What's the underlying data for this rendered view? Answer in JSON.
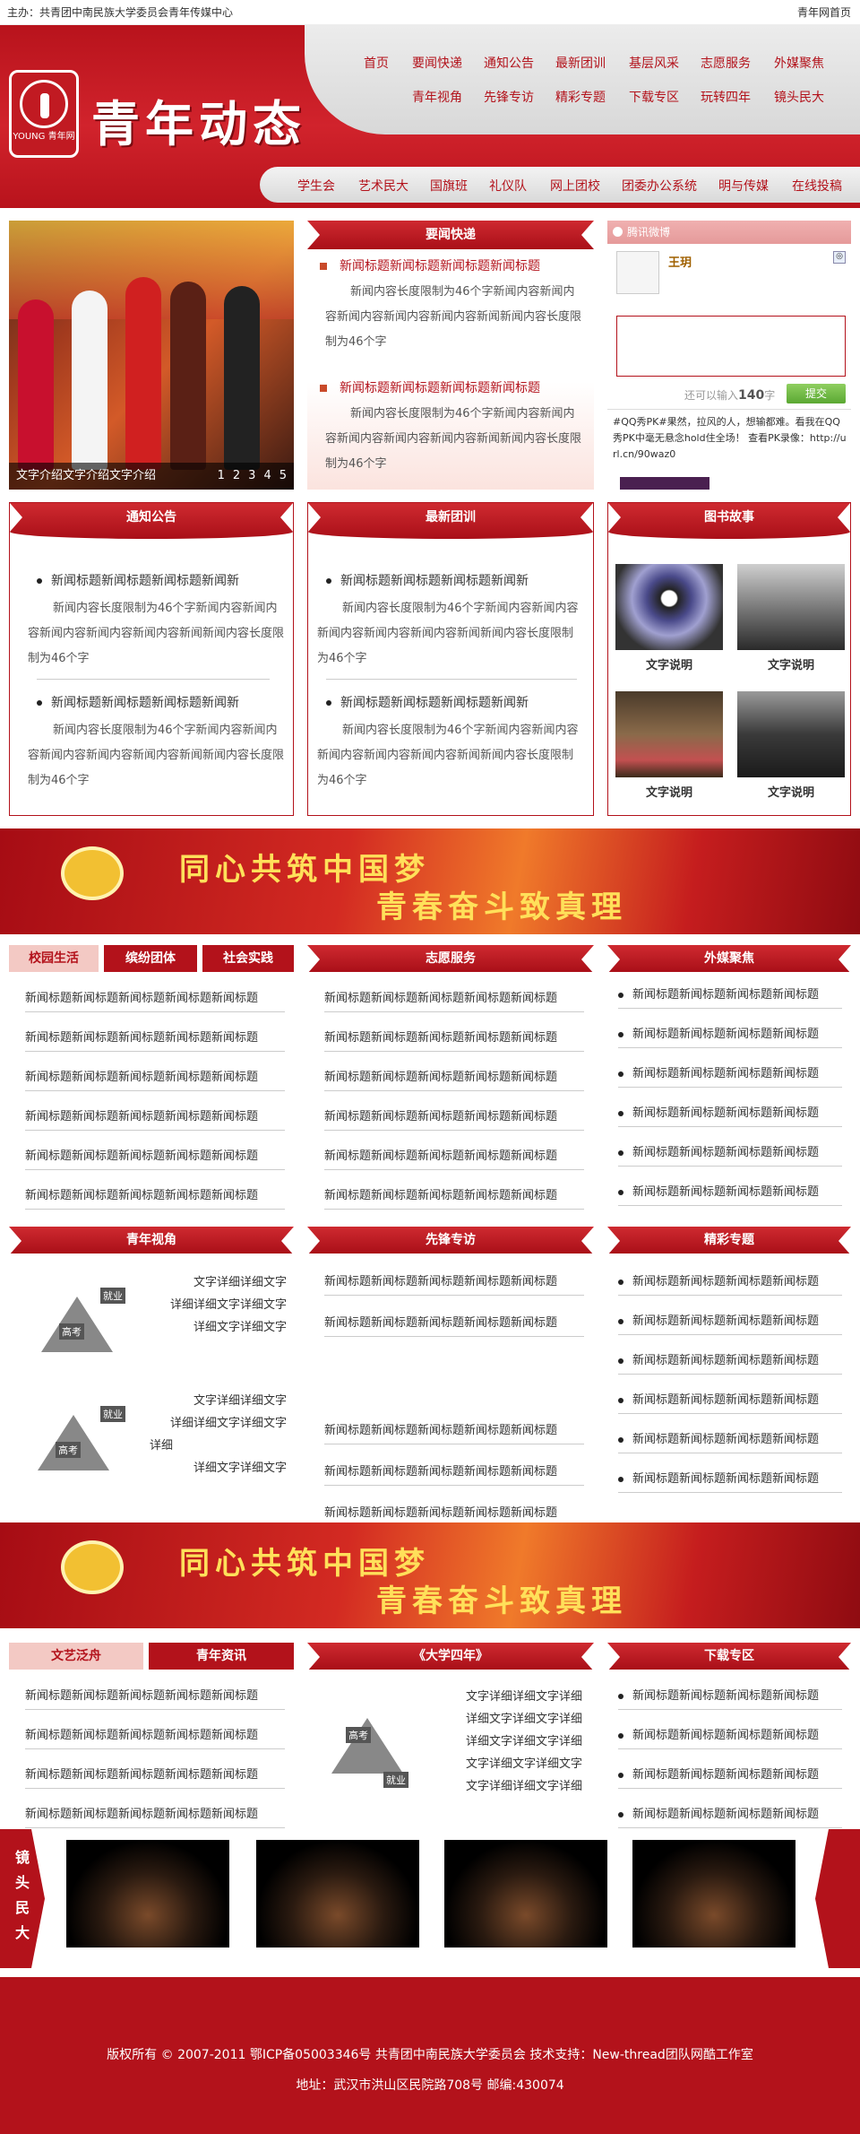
{
  "topbar": {
    "left": "主办：共青团中南民族大学委员会青年传媒中心",
    "right": "青年网首页"
  },
  "header": {
    "logo_text": "YOUNG 青年网",
    "title": "青年动态",
    "nav_row1": [
      "首页",
      "要闻快递",
      "通知公告",
      "最新团训",
      "基层风采",
      "志愿服务",
      "外媒聚焦"
    ],
    "nav_row2": [
      "青年视角",
      "先锋专访",
      "精彩专题",
      "下载专区",
      "玩转四年",
      "镜头民大"
    ],
    "subnav": [
      "学生会",
      "艺术民大",
      "国旗班",
      "礼仪队",
      "网上团校",
      "团委办公系统",
      "明与传媒",
      "在线投稿"
    ]
  },
  "slideshow": {
    "caption": "文字介绍文字介绍文字介绍",
    "pages": [
      "1",
      "2",
      "3",
      "4",
      "5"
    ]
  },
  "yaowen": {
    "title": "要闻快递",
    "items": [
      {
        "title": "新闻标题新闻标题新闻标题新闻标题",
        "desc": "新闻内容长度限制为46个字新闻内容新闻内容新闻内容新闻内容新闻内容新闻新闻内容长度限制为46个字"
      },
      {
        "title": "新闻标题新闻标题新闻标题新闻标题",
        "desc": "新闻内容长度限制为46个字新闻内容新闻内容新闻内容新闻内容新闻内容新闻新闻内容长度限制为46个字"
      }
    ]
  },
  "weibo": {
    "bar": "腾讯微博",
    "user": "王玥",
    "counter_prefix": "还可以输入",
    "counter_num": "140",
    "counter_suffix": "字",
    "submit": "提交",
    "feed": "#QQ秀PK#果然，拉风的人，想输都难。看我在QQ秀PK中毫无悬念hold住全场！ 查看PK录像：http://url.cn/90waz0"
  },
  "notice": {
    "title": "通知公告",
    "items": [
      {
        "title": "新闻标题新闻标题新闻标题新闻新",
        "desc": "新闻内容长度限制为46个字新闻内容新闻内容新闻内容新闻内容新闻内容新闻新闻内容长度限制为46个字"
      },
      {
        "title": "新闻标题新闻标题新闻标题新闻新",
        "desc": "新闻内容长度限制为46个字新闻内容新闻内容新闻内容新闻内容新闻内容新闻新闻内容长度限制为46个字"
      }
    ]
  },
  "tuanxun": {
    "title": "最新团训",
    "items": [
      {
        "title": "新闻标题新闻标题新闻标题新闻新",
        "desc": "新闻内容长度限制为46个字新闻内容新闻内容新闻内容新闻内容新闻内容新闻新闻内容长度限制为46个字"
      },
      {
        "title": "新闻标题新闻标题新闻标题新闻新",
        "desc": "新闻内容长度限制为46个字新闻内容新闻内容新闻内容新闻内容新闻内容新闻新闻内容长度限制为46个字"
      }
    ]
  },
  "books": {
    "title": "图书故事",
    "captions": [
      "文字说明",
      "文字说明",
      "文字说明",
      "文字说明"
    ]
  },
  "banner": {
    "line1": "同心共筑中国梦",
    "line2": "青春奋斗致真理"
  },
  "campus": {
    "tabs": [
      "校园生活",
      "缤纷团体",
      "社会实践"
    ],
    "items": [
      "新闻标题新闻标题新闻标题新闻标题新闻标题",
      "新闻标题新闻标题新闻标题新闻标题新闻标题",
      "新闻标题新闻标题新闻标题新闻标题新闻标题",
      "新闻标题新闻标题新闻标题新闻标题新闻标题",
      "新闻标题新闻标题新闻标题新闻标题新闻标题",
      "新闻标题新闻标题新闻标题新闻标题新闻标题"
    ]
  },
  "volunteer": {
    "title": "志愿服务",
    "items": [
      "新闻标题新闻标题新闻标题新闻标题新闻标题",
      "新闻标题新闻标题新闻标题新闻标题新闻标题",
      "新闻标题新闻标题新闻标题新闻标题新闻标题",
      "新闻标题新闻标题新闻标题新闻标题新闻标题",
      "新闻标题新闻标题新闻标题新闻标题新闻标题",
      "新闻标题新闻标题新闻标题新闻标题新闻标题"
    ]
  },
  "foreign": {
    "title": "外媒聚焦",
    "items": [
      "新闻标题新闻标题新闻标题新闻标题",
      "新闻标题新闻标题新闻标题新闻标题",
      "新闻标题新闻标题新闻标题新闻标题",
      "新闻标题新闻标题新闻标题新闻标题",
      "新闻标题新闻标题新闻标题新闻标题",
      "新闻标题新闻标题新闻标题新闻标题"
    ]
  },
  "youth_view": {
    "title": "青年视角",
    "cartoon_labels": [
      "就业",
      "高考"
    ],
    "items": [
      {
        "l1": "文字详细详细文字",
        "l2": "详细详细文字详细文字",
        "l3": "详细文字详细文字"
      },
      {
        "l1": "文字详细详细文字",
        "l2": "详细详细文字详细文字",
        "l2b": "详细",
        "l3": "详细文字详细文字"
      }
    ]
  },
  "pioneer": {
    "title": "先锋专访",
    "items": [
      "新闻标题新闻标题新闻标题新闻标题新闻标题",
      "新闻标题新闻标题新闻标题新闻标题新闻标题",
      "新闻标题新闻标题新闻标题新闻标题新闻标题",
      "新闻标题新闻标题新闻标题新闻标题新闻标题",
      "新闻标题新闻标题新闻标题新闻标题新闻标题"
    ]
  },
  "special": {
    "title": "精彩专题",
    "items": [
      "新闻标题新闻标题新闻标题新闻标题",
      "新闻标题新闻标题新闻标题新闻标题",
      "新闻标题新闻标题新闻标题新闻标题",
      "新闻标题新闻标题新闻标题新闻标题",
      "新闻标题新闻标题新闻标题新闻标题",
      "新闻标题新闻标题新闻标题新闻标题"
    ]
  },
  "literature": {
    "tabs": [
      "文艺泛舟",
      "青年资讯"
    ],
    "items": [
      "新闻标题新闻标题新闻标题新闻标题新闻标题",
      "新闻标题新闻标题新闻标题新闻标题新闻标题",
      "新闻标题新闻标题新闻标题新闻标题新闻标题",
      "新闻标题新闻标题新闻标题新闻标题新闻标题"
    ]
  },
  "four_years": {
    "title": "《大学四年》",
    "cartoon_labels": [
      "就业",
      "高考"
    ],
    "lines": [
      "文字详细详细文字详细",
      "详细文字详细文字详细",
      "详细文字详细文字详细",
      "文字详细文字详细文字",
      "文字详细详细文字详细"
    ]
  },
  "downloads": {
    "title": "下载专区",
    "items": [
      "新闻标题新闻标题新闻标题新闻标题",
      "新闻标题新闻标题新闻标题新闻标题",
      "新闻标题新闻标题新闻标题新闻标题",
      "新闻标题新闻标题新闻标题新闻标题"
    ]
  },
  "gallery": {
    "label": [
      "镜",
      "头",
      "民",
      "大"
    ]
  },
  "footer": {
    "line1": "版权所有 © 2007-2011 鄂ICP备05003346号 共青团中南民族大学委员会     技术支持：New-thread团队网酷工作室",
    "line2": "地址：武汉市洪山区民院路708号 邮编:430074"
  }
}
